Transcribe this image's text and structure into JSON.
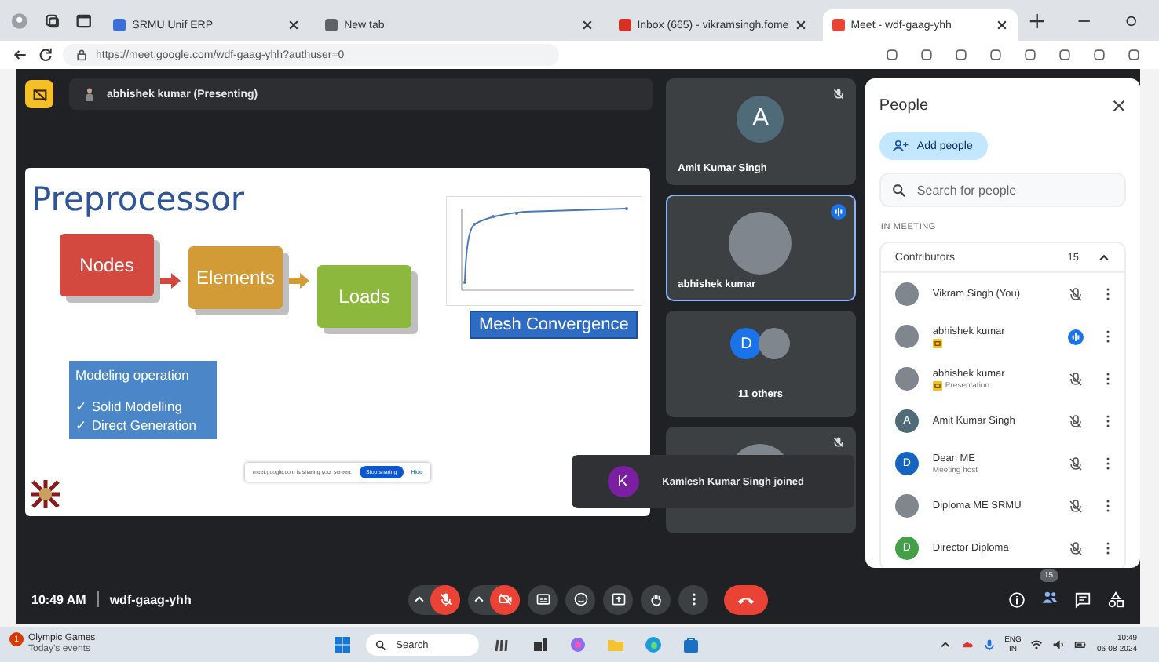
{
  "browser": {
    "tabs": [
      {
        "title": "SRMU Unif ERP",
        "selected": false
      },
      {
        "title": "New tab",
        "selected": false
      },
      {
        "title": "Inbox (665) - vikramsingh.fome",
        "selected": false
      },
      {
        "title": "Meet - wdf-gaag-yhh",
        "selected": true
      }
    ],
    "url": "https://meet.google.com/wdf-gaag-yhh?authuser=0"
  },
  "presenter_bar": {
    "label": "abhishek kumar (Presenting)"
  },
  "slide": {
    "title": "Preprocessor",
    "steps": [
      {
        "label": "Nodes",
        "color": "#d4493f"
      },
      {
        "label": "Elements",
        "color": "#d39b36"
      },
      {
        "label": "Loads",
        "color": "#8bb83d"
      }
    ],
    "modeling": {
      "heading": "Modeling operation",
      "items": [
        "✓ Solid Modelling",
        "✓ Direct Generation"
      ]
    },
    "chart_caption": "Mesh Convergence",
    "share_bar": {
      "message": "meet.google.com is sharing your screen.",
      "stop": "Stop sharing",
      "hide": "Hide"
    }
  },
  "tiles": [
    {
      "kind": "person",
      "name": "Amit Kumar Singh",
      "avatar": {
        "kind": "letter",
        "letter": "A",
        "color": "#4f6b78"
      },
      "muted": true,
      "speaking": false
    },
    {
      "kind": "person",
      "name": "abhishek kumar",
      "avatar": {
        "kind": "photo"
      },
      "muted": false,
      "speaking": true
    },
    {
      "kind": "group",
      "name": "11 others",
      "avatar": {
        "kind": "letter",
        "letter": "D",
        "color": "#1a73e8"
      },
      "muted": false,
      "speaking": false
    },
    {
      "kind": "person",
      "avatar": {
        "kind": "photo"
      },
      "muted": true,
      "speaking": false
    }
  ],
  "toast": {
    "avatar": {
      "letter": "K",
      "color": "#7b1fa2"
    },
    "text": "Kamlesh Kumar Singh joined"
  },
  "people_panel": {
    "title": "People",
    "add": "Add people",
    "search_placeholder": "Search for people",
    "section": "IN MEETING",
    "group": {
      "name": "Contributors",
      "count": "15",
      "expanded": true
    },
    "people": [
      {
        "name": "Vikram Singh (You)",
        "avatar": {
          "kind": "photo"
        },
        "presenting": false,
        "muted": true,
        "speaking": false
      },
      {
        "name": "abhishek kumar",
        "avatar": {
          "kind": "photo"
        },
        "presenting": true,
        "muted": false,
        "speaking": true
      },
      {
        "name": "abhishek kumar",
        "subtitle": "Presentation",
        "avatar": {
          "kind": "photo"
        },
        "presenting": true,
        "muted": true,
        "speaking": false
      },
      {
        "name": "Amit Kumar Singh",
        "avatar": {
          "kind": "letter",
          "letter": "A",
          "color": "#4f6b78"
        },
        "presenting": false,
        "muted": true,
        "speaking": false
      },
      {
        "name": "Dean ME",
        "subtitle": "Meeting host",
        "avatar": {
          "kind": "letter",
          "letter": "D",
          "color": "#1565c0"
        },
        "presenting": false,
        "muted": true,
        "speaking": false
      },
      {
        "name": "Diploma ME SRMU",
        "avatar": {
          "kind": "photo"
        },
        "presenting": false,
        "muted": true,
        "speaking": false
      },
      {
        "name": "Director Diploma",
        "avatar": {
          "kind": "letter",
          "letter": "D",
          "color": "#43a047"
        },
        "presenting": false,
        "muted": true,
        "speaking": false
      }
    ]
  },
  "call_bar": {
    "time": "10:49 AM",
    "code": "wdf-gaag-yhh",
    "controls": [
      {
        "kind": "mic",
        "on": false
      },
      {
        "kind": "camera",
        "on": false
      },
      {
        "kind": "captions"
      },
      {
        "kind": "emoji"
      },
      {
        "kind": "present"
      },
      {
        "kind": "hand"
      },
      {
        "kind": "more"
      },
      {
        "kind": "leave"
      }
    ],
    "people_count": "15"
  },
  "taskbar": {
    "widget_badge": "1",
    "widget_title": "Olympic Games",
    "widget_subtitle": "Today's events",
    "search": "Search",
    "lang": "ENG",
    "region": "IN",
    "time": "10:49",
    "date": "06-08-2024"
  }
}
